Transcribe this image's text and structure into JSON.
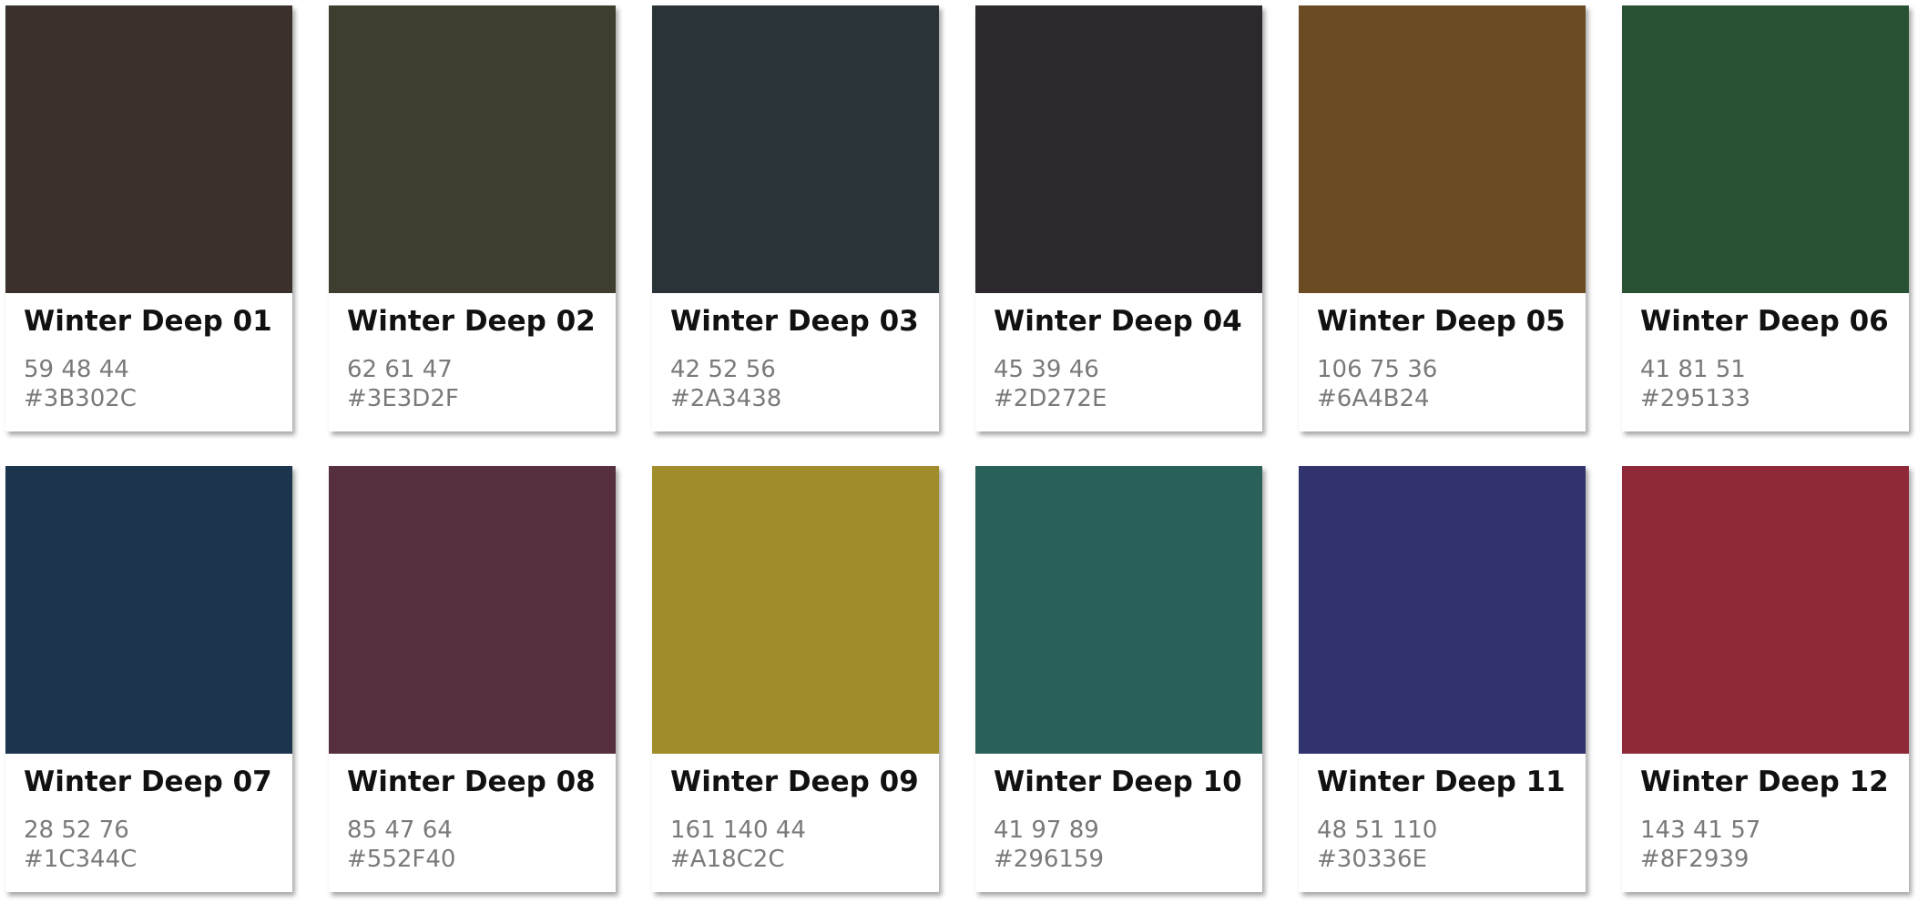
{
  "swatches": [
    {
      "name": "Winter Deep 01",
      "rgb": "59 48 44",
      "hex": "#3B302C"
    },
    {
      "name": "Winter Deep 02",
      "rgb": "62 61 47",
      "hex": "#3E3D2F"
    },
    {
      "name": "Winter Deep 03",
      "rgb": "42 52 56",
      "hex": "#2A3438"
    },
    {
      "name": "Winter Deep 04",
      "rgb": "45 39 46",
      "hex": "#2D272E"
    },
    {
      "name": "Winter Deep 05",
      "rgb": "106 75 36",
      "hex": "#6A4B24"
    },
    {
      "name": "Winter Deep 06",
      "rgb": "41 81 51",
      "hex": "#295133"
    },
    {
      "name": "Winter Deep 07",
      "rgb": "28 52 76",
      "hex": "#1C344C"
    },
    {
      "name": "Winter Deep 08",
      "rgb": "85 47 64",
      "hex": "#552F40"
    },
    {
      "name": "Winter Deep 09",
      "rgb": "161 140 44",
      "hex": "#A18C2C"
    },
    {
      "name": "Winter Deep 10",
      "rgb": "41 97 89",
      "hex": "#296159"
    },
    {
      "name": "Winter Deep 11",
      "rgb": "48 51 110",
      "hex": "#30336E"
    },
    {
      "name": "Winter Deep 12",
      "rgb": "143 41 57",
      "hex": "#8F2939"
    }
  ]
}
